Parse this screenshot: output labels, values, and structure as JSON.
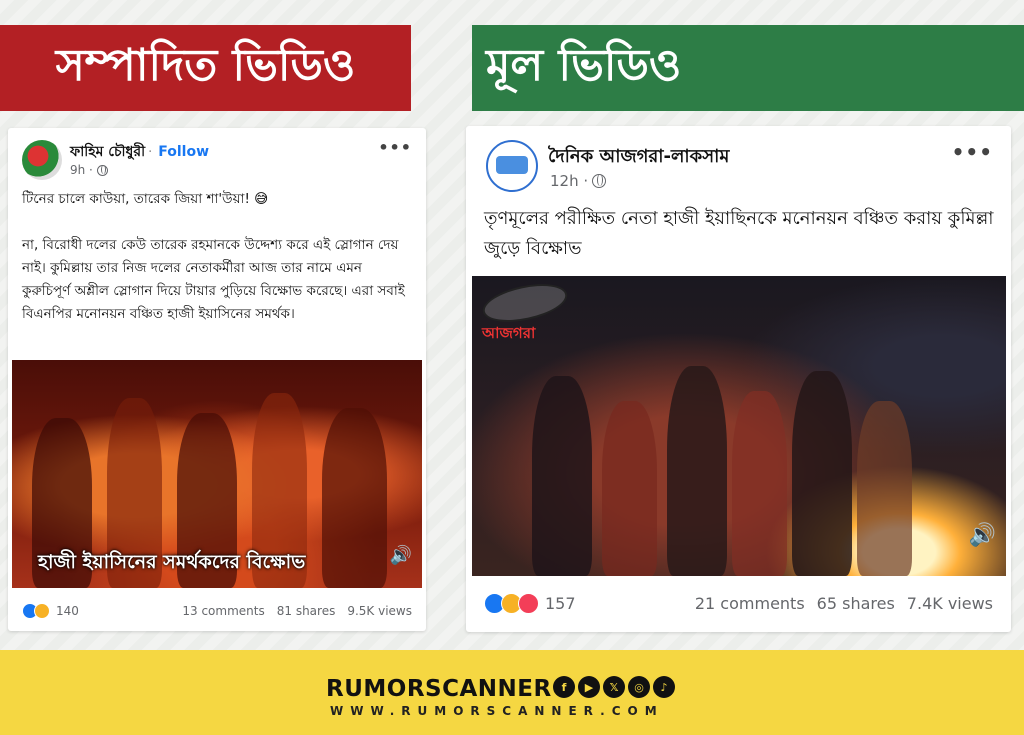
{
  "banners": {
    "edited": "সম্পাদিত ভিডিও",
    "original": "মূল ভিডিও"
  },
  "left_post": {
    "author": "ফাহিম চৌধুরী",
    "separator": "·",
    "follow": "Follow",
    "time": "9h ·",
    "text": "টিনের চালে কাউয়া, তারেক জিয়া শা'উয়া! 😅\n\nনা, বিরোধী দলের কেউ তারেক রহমানকে উদ্দেশ্য করে এই স্লোগান দেয় নাই। কুমিল্লায় তার নিজ দলের নেতাকর্মীরা আজ তার নামে এমন কুরুচিপূর্ণ অশ্লীল স্লোগান দিয়ে টায়ার পুড়িয়ে বিক্ষোভ করেছে। এরা সবাই বিএনপির মনোনয়ন বঞ্চিত হাজী ইয়াসিনের সমর্থক।",
    "video_caption": "হাজী ইয়াসিনের সমর্থকদের বিক্ষোভ",
    "reaction_count": "140",
    "comments": "13 comments",
    "shares": "81 shares",
    "views": "9.5K views",
    "reactions": [
      "like",
      "haha"
    ]
  },
  "right_post": {
    "author": "দৈনিক আজগরা-লাকসাম",
    "time": "12h ·",
    "text": "তৃণমূলের পরীক্ষিত নেতা হাজী ইয়াছিনকে মনোনয়ন বঞ্চিত করায় কুমিল্লা জুড়ে বিক্ষোভ",
    "watermark": "আজগরা",
    "reaction_count": "157",
    "comments": "21 comments",
    "shares": "65 shares",
    "views": "7.4K views",
    "reactions": [
      "like",
      "haha",
      "love"
    ]
  },
  "footer": {
    "brand": "RUMORSCANNER",
    "website": "WWW.RUMORSCANNER.COM",
    "social_icons": [
      "facebook-icon",
      "youtube-icon",
      "x-icon",
      "instagram-icon",
      "tiktok-icon"
    ]
  },
  "colors": {
    "edited_banner": "#b32024",
    "original_banner": "#2d7d46",
    "footer_band": "#f5d742",
    "facebook_blue": "#1877f2"
  }
}
